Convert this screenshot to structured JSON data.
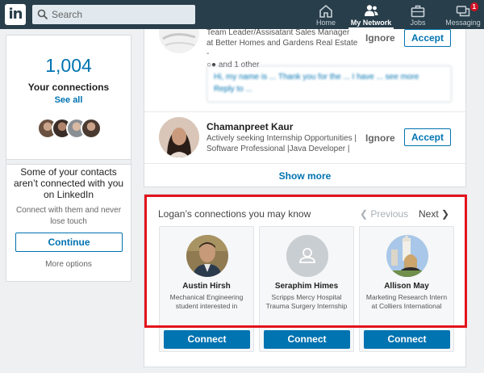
{
  "brand": {
    "logo_text": "in",
    "accent": "#0073b1",
    "nav_bg": "#283e4a",
    "highlight": "#e3141c"
  },
  "search": {
    "placeholder": "Search"
  },
  "nav": {
    "items": [
      {
        "label": "Home",
        "icon": "home-icon"
      },
      {
        "label": "My Network",
        "icon": "network-icon",
        "active": true
      },
      {
        "label": "Jobs",
        "icon": "briefcase-icon"
      },
      {
        "label": "Messaging",
        "icon": "messaging-icon",
        "badge": "1"
      }
    ]
  },
  "sidebar": {
    "connections_count": "1,004",
    "connections_label": "Your connections",
    "see_all": "See all",
    "contacts_title": "Some of your contacts aren’t connected with you on LinkedIn",
    "contacts_desc": "Connect with them and never lose touch",
    "continue_label": "Continue",
    "more_options": "More options"
  },
  "invitations": {
    "items": [
      {
        "headline": "Team Leader/Assisatant Sales Manager at Better Homes and Gardens Real Estate -",
        "mutual": "and 1 other",
        "message": "Hi, my name is ... Thank you for the ... I have ... see more",
        "reply": "Reply to ...",
        "ignore": "Ignore",
        "accept": "Accept"
      },
      {
        "name": "Chamanpreet Kaur",
        "headline": "Actively seeking Internship Opportunities | Software Professional |Java Developer |",
        "ignore": "Ignore",
        "accept": "Accept"
      }
    ],
    "show_more": "Show more"
  },
  "pymk": {
    "title": "Logan’s connections you may know",
    "previous": "Previous",
    "next": "Next",
    "people": [
      {
        "name": "Austin Hirsh",
        "headline": "Mechanical Engineering student interested in",
        "connect": "Connect"
      },
      {
        "name": "Seraphim Himes",
        "headline": "Scripps Mercy Hospital Trauma Surgery Internship",
        "connect": "Connect"
      },
      {
        "name": "Allison May",
        "headline": "Marketing Research Intern at Colliers International",
        "connect": "Connect"
      }
    ]
  }
}
